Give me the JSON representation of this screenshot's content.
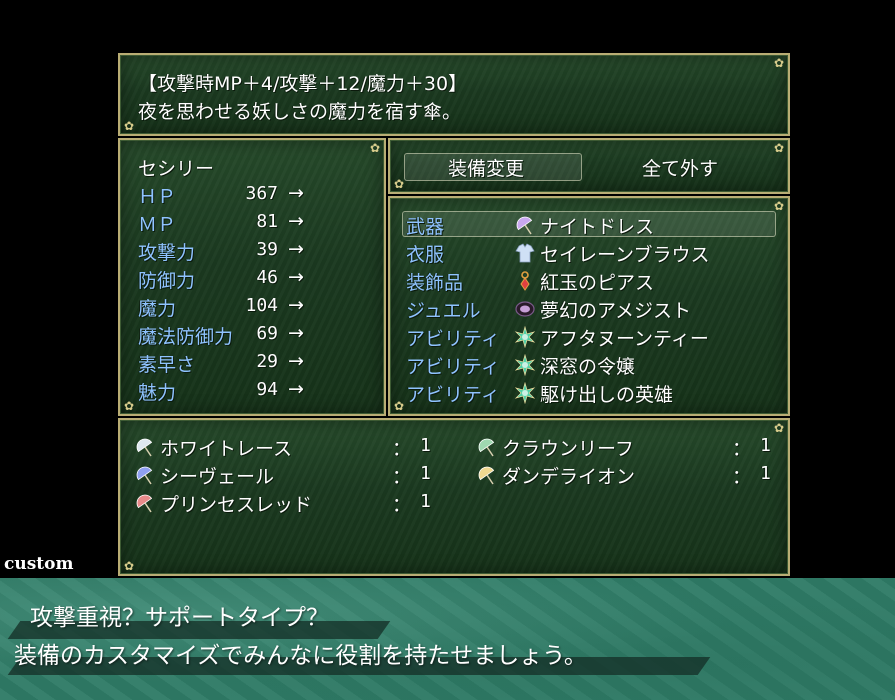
{
  "help": {
    "line1": "【攻撃時MP＋4/攻撃＋12/魔力＋30】",
    "line2": "夜を思わせる妖しさの魔力を宿す傘。"
  },
  "status": {
    "name": "セシリー",
    "stats": [
      {
        "label": "ＨＰ",
        "value": "367",
        "arrow": "→"
      },
      {
        "label": "ＭＰ",
        "value": "81",
        "arrow": "→"
      },
      {
        "label": "攻撃力",
        "value": "39",
        "arrow": "→"
      },
      {
        "label": "防御力",
        "value": "46",
        "arrow": "→"
      },
      {
        "label": "魔力",
        "value": "104",
        "arrow": "→"
      },
      {
        "label": "魔法防御力",
        "value": "69",
        "arrow": "→"
      },
      {
        "label": "素早さ",
        "value": "29",
        "arrow": "→"
      },
      {
        "label": "魅力",
        "value": "94",
        "arrow": "→"
      }
    ]
  },
  "command": {
    "change": "装備変更",
    "remove_all": "全て外す"
  },
  "slots": [
    {
      "slot": "武器",
      "item": "ナイトドレス",
      "icon": "umbrella-icon",
      "color": "#c9a8f0"
    },
    {
      "slot": "衣服",
      "item": "セイレーンブラウス",
      "icon": "blouse-icon",
      "color": "#cfe0f5"
    },
    {
      "slot": "装飾品",
      "item": "紅玉のピアス",
      "icon": "earring-icon",
      "color": "#e0a040"
    },
    {
      "slot": "ジュエル",
      "item": "夢幻のアメジスト",
      "icon": "gem-icon",
      "color": "#7a5a8a"
    },
    {
      "slot": "アビリティ",
      "item": "アフタヌーンティー",
      "icon": "ability-icon",
      "color": "#4fd0a8"
    },
    {
      "slot": "アビリティ",
      "item": "深窓の令嬢",
      "icon": "ability-icon",
      "color": "#4fd0a8"
    },
    {
      "slot": "アビリティ",
      "item": "駆け出しの英雄",
      "icon": "ability-icon",
      "color": "#4fd0a8"
    }
  ],
  "inventory": {
    "left": [
      {
        "name": "ホワイトレース",
        "colon": "：",
        "count": "1",
        "color": "#dfe8f0"
      },
      {
        "name": "シーヴェール",
        "colon": "：",
        "count": "1",
        "color": "#8f9ff0"
      },
      {
        "name": "プリンセスレッド",
        "colon": "：",
        "count": "1",
        "color": "#e88a8a"
      }
    ],
    "right": [
      {
        "name": "クラウンリーフ",
        "colon": "：",
        "count": "1",
        "color": "#9fd8b0"
      },
      {
        "name": "ダンデライオン",
        "colon": "：",
        "count": "1",
        "color": "#f0d890"
      }
    ]
  },
  "tag": "custom",
  "caption": {
    "line1": "攻撃重視？サポートタイプ？",
    "line2": "装備のカスタマイズでみんなに役割を持たせましょう。"
  }
}
